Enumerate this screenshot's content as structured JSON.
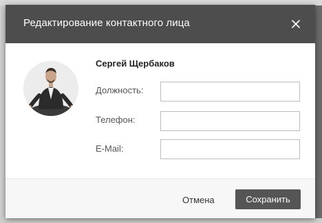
{
  "dialog": {
    "title": "Редактирование контактного лица",
    "close_icon": "close-icon"
  },
  "contact": {
    "name": "Сергей Щербаков",
    "avatar_icon": "person-avatar"
  },
  "fields": {
    "position_label": "Должность:",
    "position_value": "",
    "phone_label": "Телефон:",
    "phone_value": "",
    "email_label": "E-Mail:",
    "email_value": ""
  },
  "footer": {
    "cancel_label": "Отмена",
    "save_label": "Сохранить"
  },
  "colors": {
    "header_bg": "#4d4d4d",
    "save_bg": "#555555",
    "overlay": "#6b6b6b"
  }
}
